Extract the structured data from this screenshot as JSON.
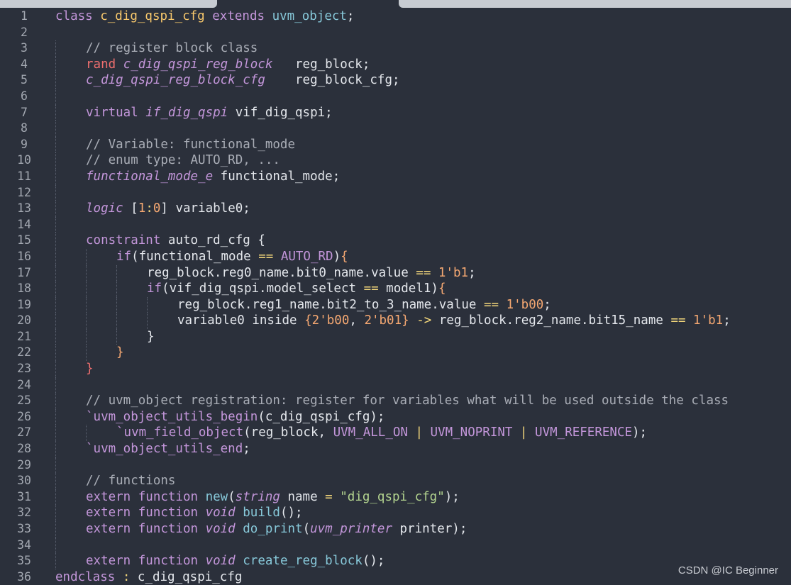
{
  "scrollbar": {
    "thumb_left": "",
    "thumb_right": ""
  },
  "watermark": "CSDN @IC Beginner",
  "lines": [
    {
      "n": "1",
      "ind": 0,
      "t": [
        [
          "kw",
          "class "
        ],
        [
          "cls",
          "c_dig_qspi_cfg"
        ],
        [
          "kw",
          " extends "
        ],
        [
          "fn",
          "uvm_object"
        ],
        [
          "pl",
          ";"
        ]
      ]
    },
    {
      "n": "2",
      "ind": 0,
      "t": []
    },
    {
      "n": "3",
      "ind": 1,
      "t": [
        [
          "cm",
          "// register block class"
        ]
      ]
    },
    {
      "n": "4",
      "ind": 1,
      "t": [
        [
          "rd",
          "rand "
        ],
        [
          "ty",
          "c_dig_qspi_reg_block"
        ],
        [
          "pl",
          "   reg_block;"
        ]
      ]
    },
    {
      "n": "5",
      "ind": 1,
      "t": [
        [
          "ty",
          "c_dig_qspi_reg_block_cfg"
        ],
        [
          "pl",
          "    reg_block_cfg;"
        ]
      ]
    },
    {
      "n": "6",
      "ind": 1,
      "t": []
    },
    {
      "n": "7",
      "ind": 1,
      "t": [
        [
          "kw",
          "virtual "
        ],
        [
          "ty",
          "if_dig_qspi"
        ],
        [
          "pl",
          " vif_dig_qspi;"
        ]
      ]
    },
    {
      "n": "8",
      "ind": 1,
      "t": []
    },
    {
      "n": "9",
      "ind": 1,
      "t": [
        [
          "cm",
          "// Variable: functional_mode"
        ]
      ]
    },
    {
      "n": "10",
      "ind": 1,
      "t": [
        [
          "cm",
          "// enum type: AUTO_RD, ..."
        ]
      ]
    },
    {
      "n": "11",
      "ind": 1,
      "t": [
        [
          "ty",
          "functional_mode_e"
        ],
        [
          "pl",
          " functional_mode;"
        ]
      ]
    },
    {
      "n": "12",
      "ind": 1,
      "t": []
    },
    {
      "n": "13",
      "ind": 1,
      "t": [
        [
          "ty",
          "logic"
        ],
        [
          "pl",
          " ["
        ],
        [
          "num",
          "1"
        ],
        [
          "op",
          ":"
        ],
        [
          "num",
          "0"
        ],
        [
          "pl",
          "] variable0;"
        ]
      ]
    },
    {
      "n": "14",
      "ind": 1,
      "t": []
    },
    {
      "n": "15",
      "ind": 1,
      "t": [
        [
          "kw",
          "constraint "
        ],
        [
          "pl",
          "auto_rd_cfg {"
        ]
      ]
    },
    {
      "n": "16",
      "ind": 2,
      "t": [
        [
          "kw",
          "if"
        ],
        [
          "pl",
          "(functional_mode "
        ],
        [
          "op",
          "=="
        ],
        [
          "mc",
          " AUTO_RD"
        ],
        [
          "pl",
          ")"
        ],
        [
          "br",
          "{"
        ]
      ]
    },
    {
      "n": "17",
      "ind": 3,
      "t": [
        [
          "pl",
          "reg_block.reg0_name.bit0_name.value "
        ],
        [
          "op",
          "=="
        ],
        [
          "num",
          " 1'b1"
        ],
        [
          "pl",
          ";"
        ]
      ]
    },
    {
      "n": "18",
      "ind": 3,
      "t": [
        [
          "kw",
          "if"
        ],
        [
          "pl",
          "(vif_dig_qspi.model_select "
        ],
        [
          "op",
          "=="
        ],
        [
          "pl",
          " model1)"
        ],
        [
          "br",
          "{"
        ]
      ]
    },
    {
      "n": "19",
      "ind": 4,
      "t": [
        [
          "pl",
          "reg_block.reg1_name.bit2_to_3_name.value "
        ],
        [
          "op",
          "=="
        ],
        [
          "num",
          " 1'b00"
        ],
        [
          "pl",
          ";"
        ]
      ]
    },
    {
      "n": "20",
      "ind": 4,
      "t": [
        [
          "pl",
          "variable0 inside "
        ],
        [
          "br",
          "{"
        ],
        [
          "num",
          "2'b00"
        ],
        [
          "pl",
          ", "
        ],
        [
          "num",
          "2'b01"
        ],
        [
          "br",
          "}"
        ],
        [
          "op",
          " ->"
        ],
        [
          "pl",
          " reg_block.reg2_name.bit15_name "
        ],
        [
          "op",
          "=="
        ],
        [
          "num",
          " 1'b1"
        ],
        [
          "pl",
          ";"
        ]
      ]
    },
    {
      "n": "21",
      "ind": 3,
      "t": [
        [
          "pl",
          "}"
        ]
      ]
    },
    {
      "n": "22",
      "ind": 2,
      "t": [
        [
          "br",
          "}"
        ]
      ]
    },
    {
      "n": "23",
      "ind": 1,
      "t": [
        [
          "rd",
          "}"
        ]
      ]
    },
    {
      "n": "24",
      "ind": 1,
      "t": []
    },
    {
      "n": "25",
      "ind": 1,
      "t": [
        [
          "cm",
          "// uvm_object registration: register for variables what will be used outside the class"
        ]
      ]
    },
    {
      "n": "26",
      "ind": 1,
      "t": [
        [
          "mc",
          "`uvm_object_utils_begin"
        ],
        [
          "pl",
          "(c_dig_qspi_cfg);"
        ]
      ]
    },
    {
      "n": "27",
      "ind": 2,
      "t": [
        [
          "mc",
          "`uvm_field_object"
        ],
        [
          "pl",
          "(reg_block, "
        ],
        [
          "mc",
          "UVM_ALL_ON"
        ],
        [
          "op",
          " | "
        ],
        [
          "mc",
          "UVM_NOPRINT"
        ],
        [
          "op",
          " | "
        ],
        [
          "mc",
          "UVM_REFERENCE"
        ],
        [
          "pl",
          ");"
        ]
      ]
    },
    {
      "n": "28",
      "ind": 1,
      "t": [
        [
          "mc",
          "`uvm_object_utils_end"
        ],
        [
          "pl",
          ";"
        ]
      ]
    },
    {
      "n": "29",
      "ind": 1,
      "t": []
    },
    {
      "n": "30",
      "ind": 1,
      "t": [
        [
          "cm",
          "// functions"
        ]
      ]
    },
    {
      "n": "31",
      "ind": 1,
      "t": [
        [
          "kw",
          "extern function "
        ],
        [
          "fn",
          "new"
        ],
        [
          "pl",
          "("
        ],
        [
          "ty",
          "string"
        ],
        [
          "pl",
          " name "
        ],
        [
          "op",
          "="
        ],
        [
          "str",
          " \"dig_qspi_cfg\""
        ],
        [
          "pl",
          ");"
        ]
      ]
    },
    {
      "n": "32",
      "ind": 1,
      "t": [
        [
          "kw",
          "extern function "
        ],
        [
          "ty",
          "void"
        ],
        [
          "fn",
          " build"
        ],
        [
          "pl",
          "();"
        ]
      ]
    },
    {
      "n": "33",
      "ind": 1,
      "t": [
        [
          "kw",
          "extern function "
        ],
        [
          "ty",
          "void"
        ],
        [
          "fn",
          " do_print"
        ],
        [
          "pl",
          "("
        ],
        [
          "ty",
          "uvm_printer"
        ],
        [
          "pl",
          " printer);"
        ]
      ]
    },
    {
      "n": "34",
      "ind": 1,
      "t": []
    },
    {
      "n": "35",
      "ind": 1,
      "t": [
        [
          "kw",
          "extern function "
        ],
        [
          "ty",
          "void"
        ],
        [
          "fn",
          " create_reg_block"
        ],
        [
          "pl",
          "();"
        ]
      ]
    },
    {
      "n": "36",
      "ind": 0,
      "t": [
        [
          "kw",
          "endclass"
        ],
        [
          "op",
          " :"
        ],
        [
          "pl",
          " c_dig_qspi_cfg"
        ]
      ]
    }
  ]
}
